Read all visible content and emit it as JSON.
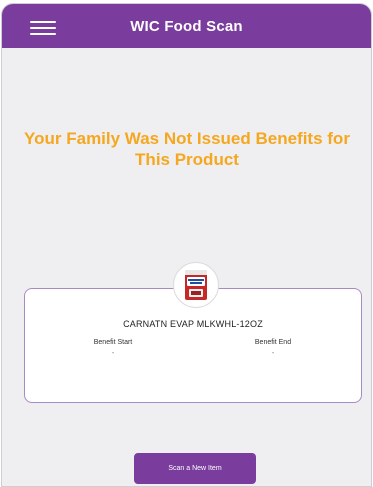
{
  "header": {
    "title": "WIC Food Scan",
    "menu_icon": "hamburger-menu-icon"
  },
  "message": {
    "text": "Your Family Was Not Issued Benefits for This Product"
  },
  "product": {
    "name": "CARNATN EVAP MLKWHL-12OZ",
    "image_icon": "evaporated-milk-can-icon",
    "benefit_start_label": "Benefit Start",
    "benefit_start_value": "-",
    "benefit_end_label": "Benefit End",
    "benefit_end_value": "-"
  },
  "actions": {
    "scan_new_item_label": "Scan a New Item"
  },
  "colors": {
    "header": "#7a3d9e",
    "message": "#f5a81f",
    "background": "#efeef0",
    "card_border": "#a98bc4"
  }
}
